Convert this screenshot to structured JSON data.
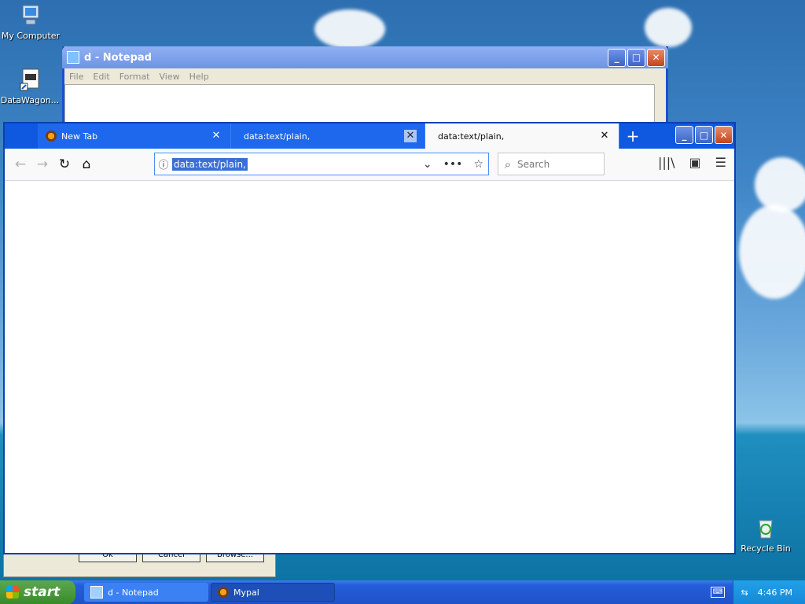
{
  "desktop": {
    "icons": [
      {
        "label": "My Computer",
        "icon": "computer-icon"
      },
      {
        "label": "DataWagon...",
        "icon": "shortcut-icon"
      },
      {
        "label": "Recycle Bin",
        "icon": "recycle-bin-icon"
      }
    ]
  },
  "notepad": {
    "title": "d - Notepad",
    "menu": [
      "File",
      "Edit",
      "Format",
      "View",
      "Help"
    ]
  },
  "dialog": {
    "buttons": [
      "Ok",
      "Cancel",
      "Browse..."
    ]
  },
  "browser": {
    "tabs": [
      {
        "label": "New Tab",
        "state": "inactive"
      },
      {
        "label": "data:text/plain,",
        "state": "inactive"
      },
      {
        "label": "data:text/plain,",
        "state": "active"
      }
    ],
    "url": "data:text/plain,",
    "search_placeholder": "Search"
  },
  "taskbar": {
    "start_label": "start",
    "tasks": [
      {
        "label": "d - Notepad"
      },
      {
        "label": "Mypal"
      }
    ],
    "clock": "4:46 PM"
  }
}
